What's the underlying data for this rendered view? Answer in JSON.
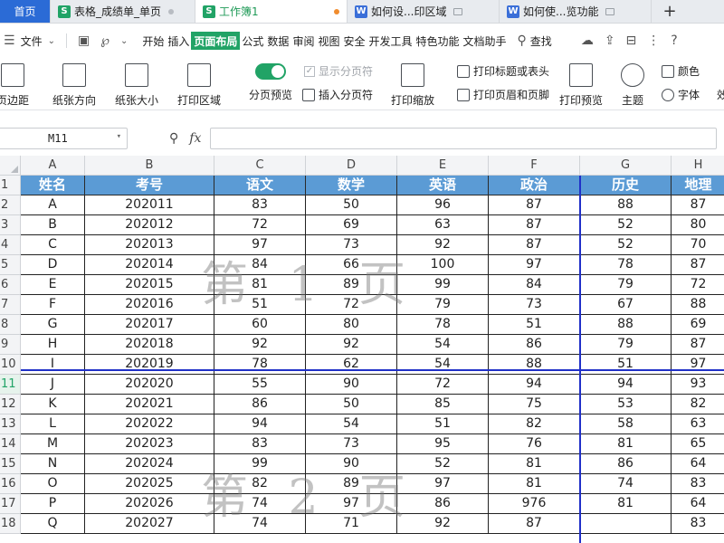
{
  "tabs": [
    {
      "label": "首页",
      "type": "home"
    },
    {
      "label": "表格_成绩单_单页",
      "type": "sheet"
    },
    {
      "label": "工作簿1",
      "type": "sheet",
      "active": true
    },
    {
      "label": "如何设...印区域",
      "type": "doc"
    },
    {
      "label": "如何使...览功能",
      "type": "doc"
    }
  ],
  "menu": {
    "file": "文件",
    "items": [
      "开始",
      "插入",
      "页面布局",
      "公式",
      "数据",
      "审阅",
      "视图",
      "安全",
      "开发工具",
      "特色功能",
      "文档助手"
    ],
    "active": "页面布局",
    "search": "查找"
  },
  "ribbon": {
    "margins": "页边距",
    "orientation": "纸张方向",
    "size": "纸张大小",
    "print_area": "打印区域",
    "page_break_preview": "分页预览",
    "show_page_breaks": "显示分页符",
    "insert_page_break": "插入分页符",
    "print_scaling": "打印缩放",
    "print_titles": "打印标题或表头",
    "header_footer": "打印页眉和页脚",
    "print_preview": "打印预览",
    "theme": "主题",
    "colors": "颜色",
    "fonts": "字体",
    "effects": "效"
  },
  "formula_bar": {
    "cell": "M11",
    "fx": "fx",
    "value": ""
  },
  "columns": [
    "A",
    "B",
    "C",
    "D",
    "E",
    "F",
    "G",
    "H"
  ],
  "headers": [
    "姓名",
    "考号",
    "语文",
    "数学",
    "英语",
    "政治",
    "历史",
    "地理"
  ],
  "rows": [
    [
      "A",
      "202011",
      "83",
      "50",
      "96",
      "87",
      "88",
      "87"
    ],
    [
      "B",
      "202012",
      "72",
      "69",
      "63",
      "87",
      "52",
      "80"
    ],
    [
      "C",
      "202013",
      "97",
      "73",
      "92",
      "87",
      "52",
      "70"
    ],
    [
      "D",
      "202014",
      "84",
      "66",
      "100",
      "97",
      "78",
      "87"
    ],
    [
      "E",
      "202015",
      "81",
      "89",
      "99",
      "84",
      "79",
      "72"
    ],
    [
      "F",
      "202016",
      "51",
      "72",
      "79",
      "73",
      "67",
      "88"
    ],
    [
      "G",
      "202017",
      "60",
      "80",
      "78",
      "51",
      "88",
      "69"
    ],
    [
      "H",
      "202018",
      "92",
      "92",
      "54",
      "86",
      "79",
      "87"
    ],
    [
      "I",
      "202019",
      "78",
      "62",
      "54",
      "88",
      "51",
      "97"
    ],
    [
      "J",
      "202020",
      "55",
      "90",
      "72",
      "94",
      "94",
      "93"
    ],
    [
      "K",
      "202021",
      "86",
      "50",
      "85",
      "75",
      "53",
      "82"
    ],
    [
      "L",
      "202022",
      "94",
      "54",
      "51",
      "82",
      "58",
      "63"
    ],
    [
      "M",
      "202023",
      "83",
      "73",
      "95",
      "76",
      "81",
      "65"
    ],
    [
      "N",
      "202024",
      "99",
      "90",
      "52",
      "81",
      "86",
      "64"
    ],
    [
      "O",
      "202025",
      "82",
      "89",
      "97",
      "81",
      "74",
      "83"
    ],
    [
      "P",
      "202026",
      "74",
      "97",
      "86",
      "976",
      "81",
      "64"
    ],
    [
      "Q",
      "202027",
      "74",
      "71",
      "92",
      "87",
      "",
      "83"
    ]
  ],
  "watermarks": [
    "第 1 页",
    "第 2 页"
  ],
  "selected_row": 11,
  "colors": {
    "accent": "#21a366",
    "header_fill": "#5b9bd5",
    "page_break": "#2030c8"
  }
}
